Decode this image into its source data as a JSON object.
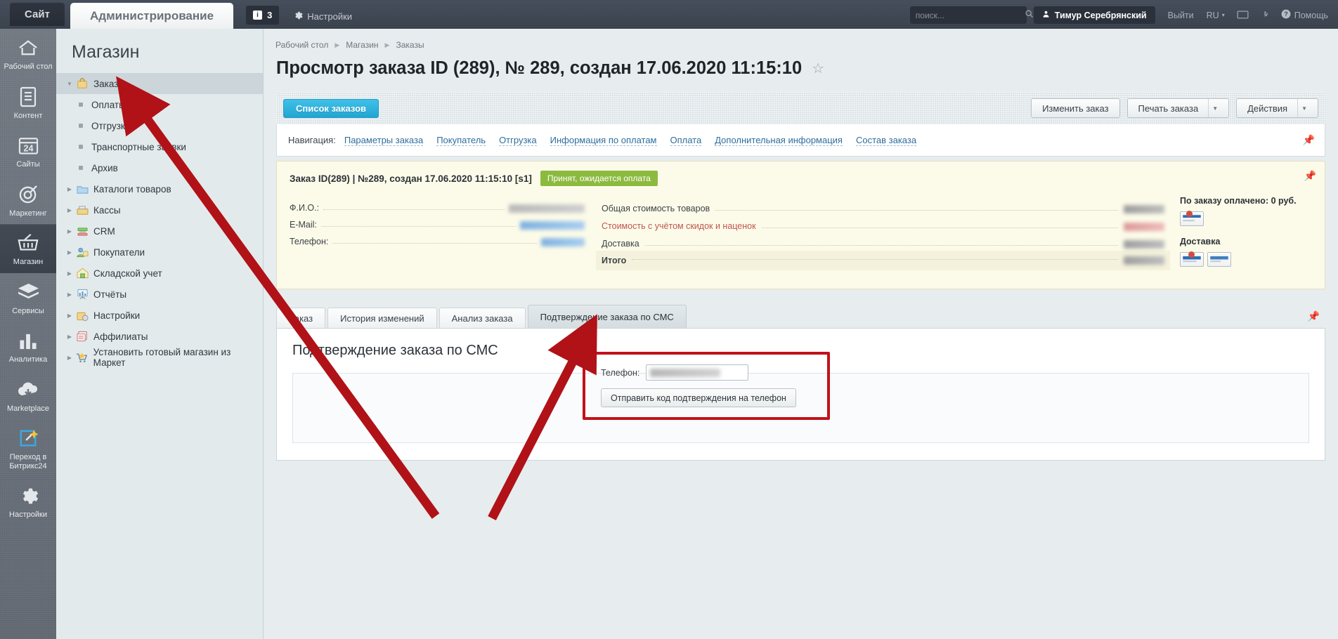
{
  "topbar": {
    "site_tab": "Сайт",
    "admin_tab": "Администрирование",
    "counter": "3",
    "counter_icon": "info-icon",
    "settings": "Настройки",
    "settings_icon": "gear-icon",
    "search_placeholder": "поиск...",
    "search_value": "",
    "search_icon": "search-icon",
    "user_name": "Тимур Серебрянский",
    "user_icon": "user-icon",
    "logout": "Выйти",
    "lang": "RU",
    "monitor_icon": "monitor-icon",
    "pin_icon": "pin-icon",
    "help": "Помощь",
    "help_icon": "question-icon"
  },
  "rail": {
    "items": [
      {
        "label": "Рабочий стол",
        "icon": "home-icon",
        "active": false
      },
      {
        "label": "Контент",
        "icon": "document-icon",
        "active": false
      },
      {
        "label": "Сайты",
        "icon": "calendar-24-icon",
        "active": false
      },
      {
        "label": "Маркетинг",
        "icon": "target-icon",
        "active": false
      },
      {
        "label": "Магазин",
        "icon": "basket-icon",
        "active": true
      },
      {
        "label": "Сервисы",
        "icon": "layers-icon",
        "active": false
      },
      {
        "label": "Аналитика",
        "icon": "bar-chart-icon",
        "active": false
      },
      {
        "label": "Marketplace",
        "icon": "cloud-download-icon",
        "active": false
      },
      {
        "label": "Переход в Битрикс24",
        "icon": "magic-wand-icon",
        "active": false
      },
      {
        "label": "Настройки",
        "icon": "gear-icon",
        "active": false
      }
    ]
  },
  "tree": {
    "title": "Магазин",
    "items": [
      {
        "label": "Заказы",
        "icon": "orders-bag-icon",
        "expanded": true,
        "selected": true,
        "child": false
      },
      {
        "label": "Оплаты",
        "child": true
      },
      {
        "label": "Отгрузки",
        "child": true
      },
      {
        "label": "Транспортные заявки",
        "child": true
      },
      {
        "label": "Архив",
        "child": true
      },
      {
        "label": "Каталоги товаров",
        "icon": "folder-icon",
        "expanded": false,
        "child": false
      },
      {
        "label": "Кассы",
        "icon": "cash-register-icon",
        "expanded": false,
        "child": false
      },
      {
        "label": "CRM",
        "icon": "crm-icon",
        "expanded": false,
        "child": false
      },
      {
        "label": "Покупатели",
        "icon": "customers-icon",
        "expanded": false,
        "child": false
      },
      {
        "label": "Складской учет",
        "icon": "warehouse-icon",
        "expanded": false,
        "child": false
      },
      {
        "label": "Отчёты",
        "icon": "reports-icon",
        "expanded": false,
        "child": false
      },
      {
        "label": "Настройки",
        "icon": "settings-bag-icon",
        "expanded": false,
        "child": false
      },
      {
        "label": "Аффилиаты",
        "icon": "affiliates-icon",
        "expanded": false,
        "child": false
      },
      {
        "label": "Установить готовый магазин из Маркет",
        "icon": "market-cart-icon",
        "expanded": false,
        "child": false
      }
    ]
  },
  "breadcrumb": {
    "items": [
      "Рабочий стол",
      "Магазин",
      "Заказы"
    ]
  },
  "page": {
    "title": "Просмотр заказа ID (289), № 289, создан 17.06.2020 11:15:10",
    "star_icon": "star-outline-icon"
  },
  "toolbar": {
    "orders_list": "Список заказов",
    "edit_order": "Изменить заказ",
    "print_order": "Печать заказа",
    "actions": "Действия"
  },
  "nav": {
    "label": "Навигация:",
    "links": [
      "Параметры заказа",
      "Покупатель",
      "Отгрузка",
      "Информация по оплатам",
      "Оплата",
      "Дополнительная информация",
      "Состав заказа"
    ],
    "pin_icon": "pin-icon"
  },
  "summary": {
    "header": "Заказ ID(289) | №289, создан 17.06.2020 11:15:10 [s1]",
    "status_badge": "Принят, ожидается оплата",
    "status_color": "#8cba3f",
    "customer_fields": [
      {
        "label": "Ф.И.О.:",
        "value": "",
        "masked": true,
        "mask": "gray"
      },
      {
        "label": "E-Mail:",
        "value": "",
        "masked": true,
        "mask": "blue"
      },
      {
        "label": "Телефон:",
        "value": "",
        "masked": true,
        "mask": "blue2"
      }
    ],
    "money_rows": [
      {
        "label": "Общая стоимость товаров",
        "value": "",
        "masked": true,
        "mask": "dark",
        "accent": false
      },
      {
        "label": "Стоимость с учётом скидок и наценок",
        "value": "",
        "masked": true,
        "mask": "red",
        "accent": true
      },
      {
        "label": "Доставка",
        "value": "",
        "masked": true,
        "mask": "dark",
        "accent": false
      },
      {
        "label": "Итого",
        "value": "",
        "masked": true,
        "mask": "dark",
        "accent": false,
        "total": true
      }
    ],
    "paid_label": "По заказу оплачено: 0 руб.",
    "delivery_label": "Доставка",
    "pin_icon": "pin-icon"
  },
  "tabs": {
    "items": [
      {
        "label": "Заказ",
        "active": false
      },
      {
        "label": "История изменений",
        "active": false
      },
      {
        "label": "Анализ заказа",
        "active": false
      },
      {
        "label": "Подтверждение заказа по СМС",
        "active": true
      }
    ],
    "pin_icon": "pin-icon"
  },
  "sms_panel": {
    "heading": "Подтверждение заказа по СМС",
    "phone_label": "Телефон:",
    "phone_value": "",
    "send_button": "Отправить код подтверждения на телефон",
    "highlight_color": "#c1121b"
  },
  "annotations": {
    "arrow_color": "#b01217",
    "arrow_to_orders": "Заказы",
    "arrow_to_sms_tab": "Подтверждение заказа по СМС"
  }
}
